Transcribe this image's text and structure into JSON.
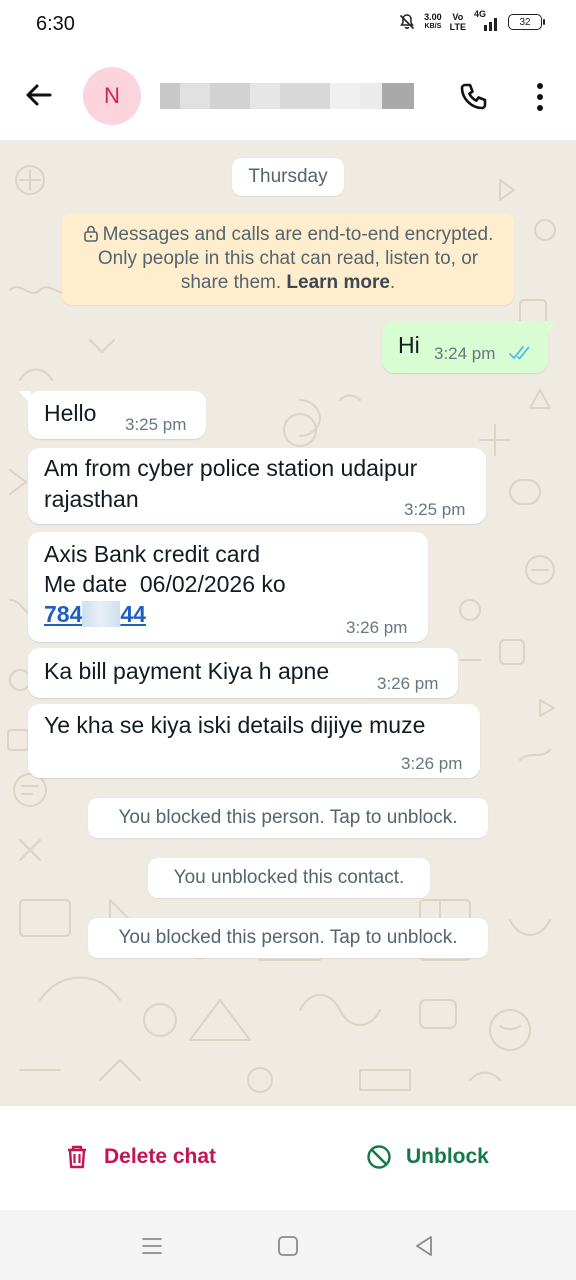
{
  "status_bar": {
    "time": "6:30",
    "net_speed": "3.00",
    "net_unit": "KB/S",
    "volte_top": "Vo",
    "volte_bottom": "LTE",
    "network": "4G",
    "battery": "32"
  },
  "header": {
    "avatar_initial": "N",
    "contact_name_redacted": true
  },
  "chat": {
    "date_label": "Thursday",
    "encryption_notice": {
      "text": "Messages and calls are end-to-end encrypted. Only people in this chat can read, listen to, or share them.",
      "learn_more": "Learn more",
      "trailing": "."
    },
    "messages": [
      {
        "direction": "out",
        "text": "Hi",
        "time": "3:24 pm",
        "status": "read"
      },
      {
        "direction": "in",
        "text": "Hello",
        "time": "3:25 pm"
      },
      {
        "direction": "in",
        "line1": "Am from cyber police station udaipur",
        "line2": "rajasthan",
        "time": "3:25 pm"
      },
      {
        "direction": "in",
        "line1": "Axis Bank credit card",
        "line2": "Me date  06/02/2026 ko",
        "phone_start": "784",
        "phone_end": "44",
        "time": "3:26 pm"
      },
      {
        "direction": "in",
        "text": "Ka bill payment Kiya h apne",
        "time": "3:26 pm"
      },
      {
        "direction": "in",
        "text": "Ye kha se kiya iski details dijiye muze",
        "time": "3:26 pm"
      }
    ],
    "system_messages": [
      "You blocked this person. Tap to unblock.",
      "You unblocked this contact.",
      "You blocked this person. Tap to unblock."
    ]
  },
  "actions": {
    "delete_label": "Delete chat",
    "unblock_label": "Unblock",
    "delete_color": "#c4154f",
    "unblock_color": "#13784b"
  },
  "theme": {
    "chat_background": "#efeae2",
    "outgoing_bubble": "#d9fdd3",
    "incoming_bubble": "#ffffff",
    "notice_background": "#ffeecd"
  }
}
